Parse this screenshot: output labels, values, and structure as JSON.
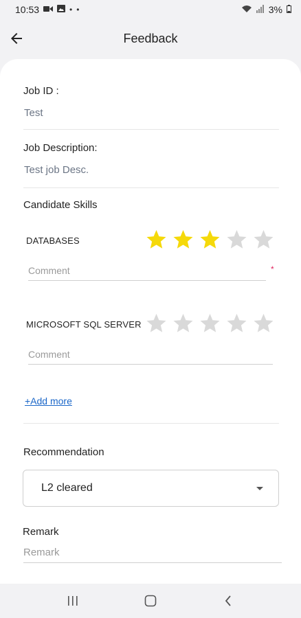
{
  "status_bar": {
    "time": "10:53",
    "battery": "3%",
    "icons": [
      "video-icon",
      "image-icon",
      "notification-dot-icon",
      "notification-dot-icon",
      "wifi-icon",
      "signal-icon",
      "battery-icon"
    ]
  },
  "app_bar": {
    "title": "Feedback",
    "back_icon": "arrow-left-icon"
  },
  "job": {
    "id_label": "Job ID :",
    "id_value": "Test",
    "description_label": "Job Description:",
    "description_value": "Test job Desc."
  },
  "skills": {
    "heading": "Candidate Skills",
    "items": [
      {
        "name": "DATABASES",
        "rating": 3,
        "max_rating": 5,
        "comment_placeholder": "Comment",
        "required": true,
        "required_mark": "*"
      },
      {
        "name": "MICROSOFT SQL SERVER",
        "rating": 0,
        "max_rating": 5,
        "comment_placeholder": "Comment",
        "required": false
      }
    ],
    "add_more_label": "+Add more"
  },
  "recommendation": {
    "label": "Recommendation",
    "selected": "L2 cleared"
  },
  "remark": {
    "label": "Remark",
    "placeholder": "Remark"
  },
  "colors": {
    "star_filled": "#f5d90a",
    "star_empty": "#d9d9d9",
    "link": "#1a66c8",
    "required": "#e0245e"
  },
  "nav_bar": {
    "icons": [
      "recent-apps-icon",
      "home-icon",
      "back-nav-icon"
    ]
  }
}
